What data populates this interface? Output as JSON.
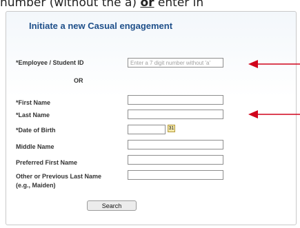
{
  "caption": {
    "part1": "number (without the a) ",
    "emph": "or",
    "part2": " enter in"
  },
  "form": {
    "title": "Initiate a new Casual engagement",
    "employee_label": "*Employee / Student ID",
    "employee_placeholder": "Enter a 7 digit number without 'a'",
    "or_label": "OR",
    "first_name_label": "*First Name",
    "last_name_label": "*Last Name",
    "dob_label": "*Date of Birth",
    "middle_name_label": "Middle Name",
    "preferred_name_label": "Preferred First Name",
    "other_last_name_label": "Other or Previous Last Name",
    "other_last_name_hint": "(e.g., Maiden)",
    "calendar_glyph": "31",
    "search_label": "Search"
  },
  "colors": {
    "title": "#1e4f8a",
    "arrow": "#d0021b"
  },
  "icons": [
    "calendar-icon",
    "arrow-icon"
  ]
}
